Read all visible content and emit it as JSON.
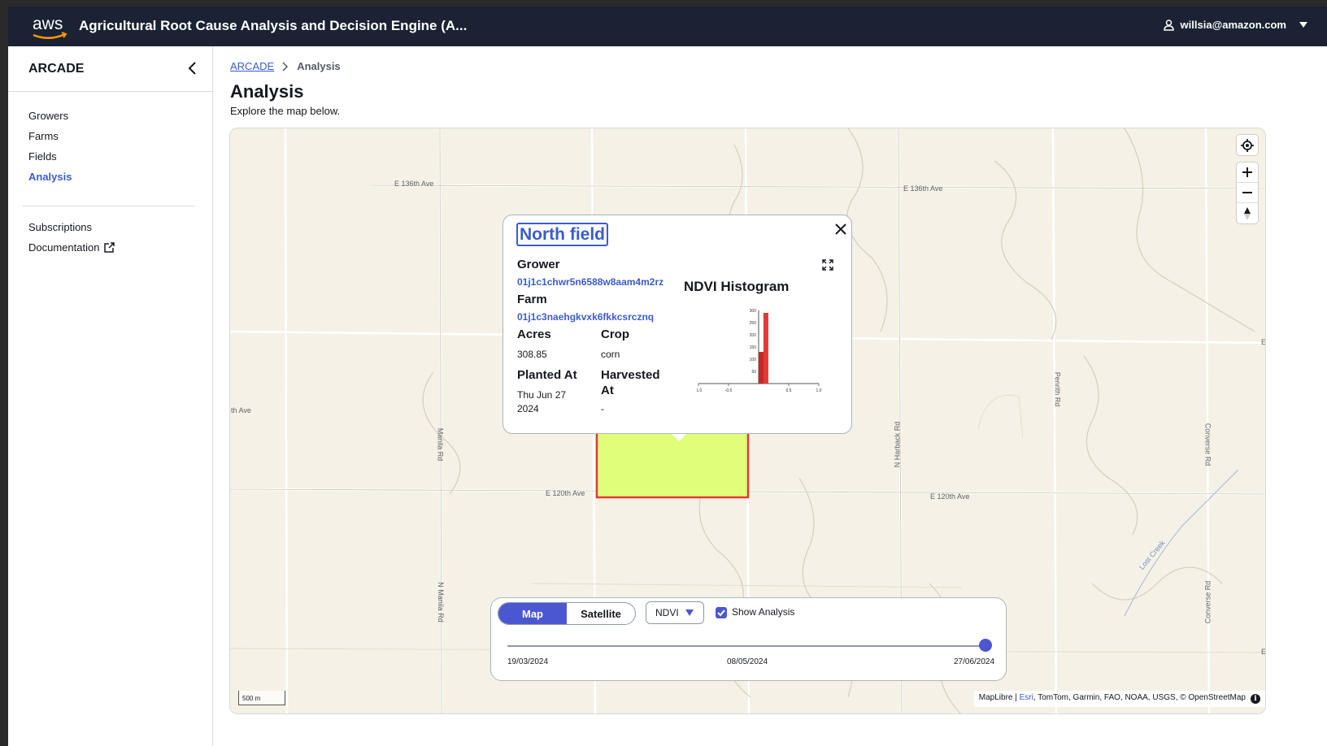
{
  "header": {
    "logo_text": "aws",
    "app_title": "Agricultural Root Cause Analysis and Decision Engine (A...",
    "user_email": "willsia@amazon.com"
  },
  "sidebar": {
    "title": "ARCADE",
    "items": [
      {
        "label": "Growers"
      },
      {
        "label": "Farms"
      },
      {
        "label": "Fields"
      },
      {
        "label": "Analysis",
        "active": true
      }
    ],
    "secondary": [
      {
        "label": "Subscriptions"
      },
      {
        "label": "Documentation",
        "icon": "external-link-icon"
      }
    ]
  },
  "breadcrumb": [
    "ARCADE",
    "Analysis"
  ],
  "page": {
    "title": "Analysis",
    "subtitle": "Explore the map below."
  },
  "map": {
    "road_labels": [
      "E 136th Ave",
      "E 136th Ave",
      "th Ave",
      "Manila Rd",
      "E 120th Ave",
      "E 120th Ave",
      "N Harback Rd",
      "Penrith Rd",
      "Converse Rd",
      "N Manila Rd",
      "Converse Rd",
      "Lost Creek",
      "E",
      "E"
    ],
    "scale": "500 m",
    "attribution": {
      "prefix": "MapLibre | ",
      "esri": "Esri",
      "rest": ", TomTom, Garmin, FAO, NOAA, USGS, © OpenStreetMap"
    },
    "field_color": "#dfff7a",
    "field_border_color": "#e53935"
  },
  "popup": {
    "title": "North field",
    "grower_label": "Grower",
    "grower_id": "01j1c1chwr5n6588w8aam4m2rz",
    "farm_label": "Farm",
    "farm_id": "01j1c3naehgkvxk6fkkcsrcznq",
    "acres_label": "Acres",
    "acres_value": "308.85",
    "crop_label": "Crop",
    "crop_value": "corn",
    "planted_label": "Planted At",
    "planted_value_1": "Thu Jun 27",
    "planted_value_2": "2024",
    "harvested_label_1": "Harvested",
    "harvested_label_2": "At",
    "harvested_value": "-",
    "histogram_title": "NDVI Histogram"
  },
  "chart_data": {
    "type": "bar",
    "title": "NDVI Histogram",
    "x_ticks": [
      "-1.0",
      "-0.5",
      "0.5",
      "1.0"
    ],
    "y_ticks": [
      "50",
      "100",
      "150",
      "200",
      "250",
      "300"
    ],
    "xlim": [
      -1.0,
      1.0
    ],
    "ylim": [
      0,
      300
    ],
    "bars": [
      {
        "x": 0.0,
        "value": 130
      },
      {
        "x": 0.08,
        "value": 290
      }
    ],
    "bar_color": "#e53935"
  },
  "controls": {
    "view_options": [
      "Map",
      "Satellite"
    ],
    "selected_view": "Map",
    "layer_select": "NDVI",
    "show_analysis_label": "Show Analysis",
    "show_analysis_checked": true,
    "slider_labels": [
      "19/03/2024",
      "08/05/2024",
      "27/06/2024"
    ],
    "slider_value": "27/06/2024"
  }
}
